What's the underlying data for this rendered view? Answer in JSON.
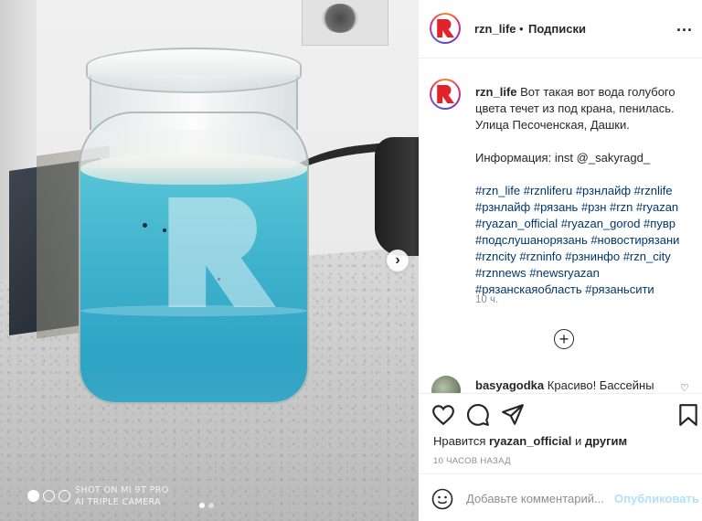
{
  "post": {
    "username": "rzn_life",
    "separator": "•",
    "follow_label": "Подписки",
    "more_label": "...",
    "caption_line1": "Вот такая вот вода голубого цвета течет из под крана, пенилась. Улица Песоченская, Дашки.",
    "info_line": "Информация: inst @_sakyragd_",
    "hashtags": "#rzn_life #rznliferu #рзнлайф #rznlife #рзнлайф #рязань #рзн #rzn #ryazan #ryazan_official #ryazan_gorod #пувр #подслушанорязань #новостирязани #rzncity #rzninfo #рзнинфо #rzn_city #rznnews #newsryazan #рязанскаяобласть #рязаньсити",
    "time": "10 ч.",
    "add_icon": "plus-circle-icon"
  },
  "comment": {
    "username": "basyagodka",
    "text": "Красиво! Бассейны"
  },
  "actions": {
    "liked_by_prefix": "Нравится",
    "liked_by_user": "ryazan_official",
    "liked_by_and": "и",
    "liked_by_others": "другим",
    "time_ago": "10 ЧАСОВ НАЗАД"
  },
  "composer": {
    "placeholder": "Добавьте комментарий...",
    "publish_label": "Опубликовать"
  },
  "photo": {
    "camera_line1": "SHOT ON MI 9T PRO",
    "camera_line2": "AI TRIPLE CAMERA",
    "next_symbol": "›",
    "slides": 3,
    "current_slide": 1
  },
  "colors": {
    "brand_red": "#e2232a",
    "link_blue": "#00376b",
    "publish_disabled": "#b2dffc",
    "water_blue": "#3fb2cc"
  }
}
